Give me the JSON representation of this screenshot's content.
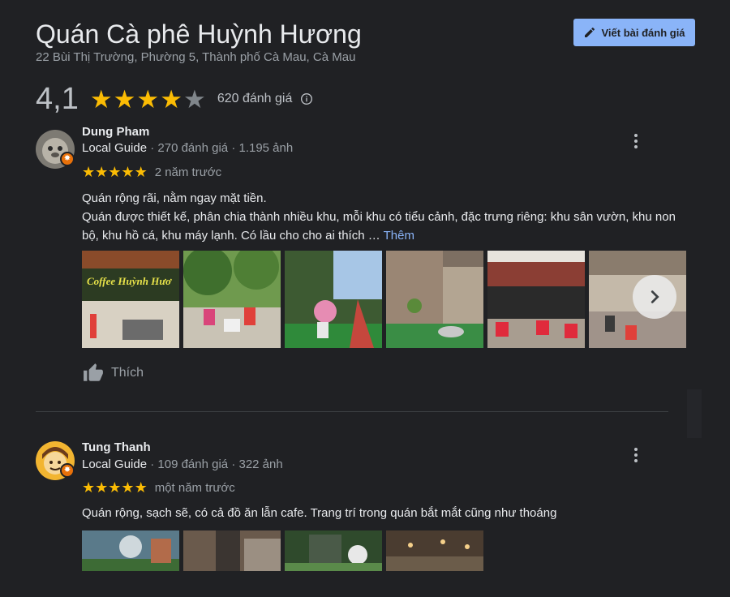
{
  "place": {
    "name": "Quán Cà phê Huỳnh Hương",
    "address": "22 Bùi Thị Trường, Phường 5, Thành phố Cà Mau, Cà Mau",
    "write_review_label": "Viết bài đánh giá",
    "rating": "4,1",
    "rating_value": 4.1,
    "review_count_label": "620 đánh giá"
  },
  "reviews": [
    {
      "author": "Dung Pham",
      "badge": "Local Guide",
      "stats": "· 270 đánh giá · 1.195 ảnh",
      "stars": 5,
      "time": "2 năm trước",
      "text_line1": "Quán rộng rãi, nằm ngay mặt tiền.",
      "text_line2": "Quán được thiết kế, phân chia thành nhiều khu, mỗi khu có tiểu cảnh, đặc trưng riêng: khu sân vườn, khu non bộ, khu hồ cá, khu máy lạnh. Có lầu cho cho ai thích …",
      "more_label": "Thêm",
      "like_label": "Thích"
    },
    {
      "author": "Tung Thanh",
      "badge": "Local Guide",
      "stats": "· 109 đánh giá · 322 ảnh",
      "stars": 5,
      "time": "một năm trước",
      "text": "Quán rộng, sạch sẽ, có cả đồ ăn lẫn cafe. Trang trí trong quán bắt mắt cũng như thoáng"
    }
  ],
  "photo_sign_text": "Coffee Huỳnh Hươ",
  "colors": {
    "background": "#202124",
    "star": "#fbbc04",
    "star_empty": "#5f6368",
    "accent_button": "#8ab4f8",
    "link": "#8ab4f8",
    "guide_badge": "#e8710a"
  }
}
